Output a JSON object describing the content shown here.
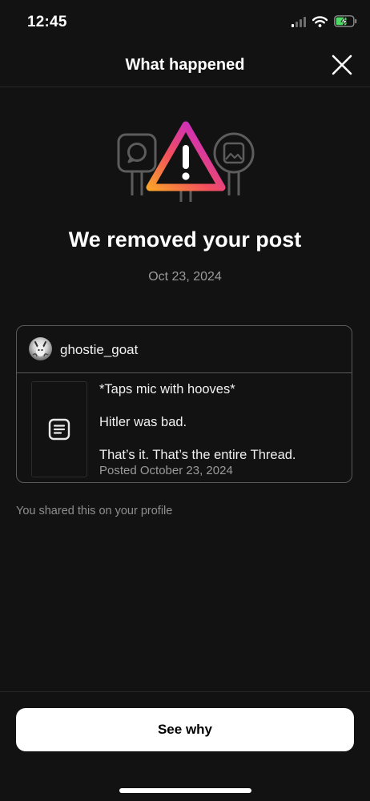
{
  "status_bar": {
    "time": "12:45",
    "icons": [
      "cellular-signal-icon",
      "wifi-icon",
      "battery-charging-icon"
    ]
  },
  "header": {
    "title": "What happened",
    "close_icon": "close-icon"
  },
  "illustration": {
    "icons": [
      "comment-sign-icon",
      "warning-triangle-icon",
      "image-sign-icon"
    ],
    "gradient_colors": [
      "#f9a12b",
      "#f14f5e",
      "#d232b2",
      "#8a3dd6"
    ]
  },
  "headline": "We removed your post",
  "date": "Oct 23, 2024",
  "post": {
    "username": "ghostie_goat",
    "avatar_icon": "avatar",
    "thumbnail_icon": "text-post-icon",
    "lines": [
      "*Taps mic with hooves*",
      "Hitler was bad.",
      "That’s it. That’s the entire Thread."
    ],
    "posted": "Posted October 23, 2024"
  },
  "shared_note": "You shared this on your profile",
  "button": {
    "label": "See why"
  },
  "colors": {
    "background": "#121212",
    "button_bg": "#ffffff",
    "secondary_text": "#9a9a9a"
  }
}
